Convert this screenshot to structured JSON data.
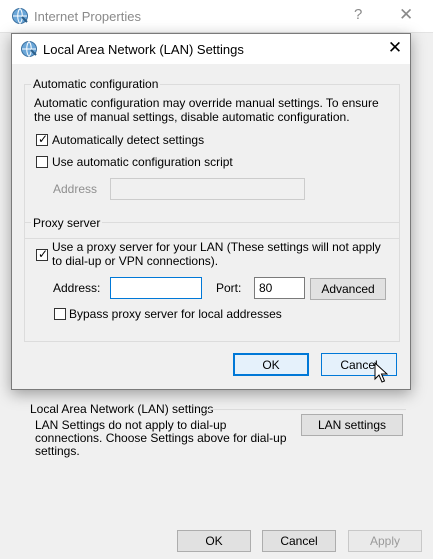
{
  "bg_window": {
    "title": "Internet Properties",
    "help_glyph": "?",
    "close_glyph": "✕",
    "lan_group_label": "Local Area Network (LAN) settings",
    "lan_group_desc": "LAN Settings do not apply to dial-up connections. Choose Settings above for dial-up settings.",
    "lan_settings_button": "LAN settings",
    "footer_buttons": {
      "ok": "OK",
      "cancel": "Cancel",
      "apply": "Apply"
    }
  },
  "dialog": {
    "title": "Local Area Network (LAN) Settings",
    "close_glyph": "✕",
    "auto_config": {
      "legend": "Automatic configuration",
      "description": "Automatic configuration may override manual settings.  To ensure the use of manual settings, disable automatic configuration.",
      "detect_label": "Automatically detect settings",
      "detect_checked": true,
      "script_label": "Use automatic configuration script",
      "script_checked": false,
      "address_label": "Address",
      "address_value": ""
    },
    "proxy": {
      "legend": "Proxy server",
      "use_proxy_label": "Use a proxy server for your LAN (These settings will not apply to dial-up or VPN connections).",
      "use_proxy_checked": true,
      "address_label": "Address:",
      "address_value": "",
      "port_label": "Port:",
      "port_value": "80",
      "advanced_button": "Advanced",
      "bypass_label": "Bypass proxy server for local addresses",
      "bypass_checked": false
    },
    "ok_button": "OK",
    "cancel_button": "Cancel"
  },
  "check_glyph": "✓",
  "colors": {
    "accent": "#0078d7",
    "window_bg": "#f0f0f0"
  }
}
